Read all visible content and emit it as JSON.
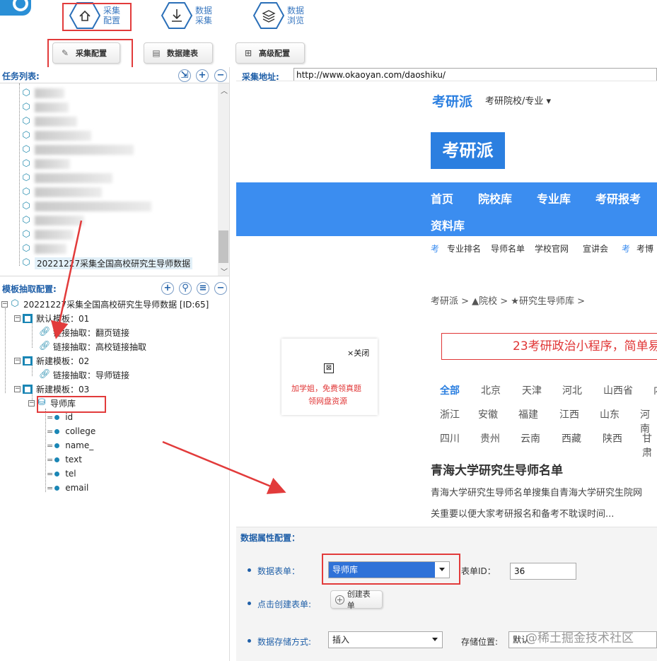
{
  "toolbar": {
    "buttons": [
      {
        "label_l1": "采集",
        "label_l2": "配置"
      },
      {
        "label_l1": "数据",
        "label_l2": "采集"
      },
      {
        "label_l1": "数据",
        "label_l2": "浏览"
      }
    ]
  },
  "subtabs": [
    {
      "label": "采集配置"
    },
    {
      "label": "数据建表"
    },
    {
      "label": "高级配置"
    }
  ],
  "task_list": {
    "label": "任务列表:",
    "last_item": "20221227采集全国高校研究生导师数据"
  },
  "url_bar": {
    "label": "采集地址:",
    "value": "http://www.okaoyan.com/daoshiku/"
  },
  "template_config": {
    "label": "模板抽取配置:",
    "root": "20221227采集全国高校研究生导师数据 [ID:65]",
    "templates": [
      {
        "name": "默认模板：01",
        "children": [
          "链接抽取：翻页链接",
          "链接抽取：高校链接抽取"
        ]
      },
      {
        "name": "新建模板：02",
        "children": [
          "链接抽取：导师链接"
        ]
      },
      {
        "name": "新建模板：03",
        "children": []
      }
    ],
    "table_node": "导师库",
    "fields": [
      "id",
      "college",
      "name_",
      "text",
      "tel",
      "email"
    ]
  },
  "site": {
    "brand": "考研派",
    "brand_menu": "考研院校/专业 ▾",
    "logo_text": "考研派",
    "nav": [
      "首页",
      "院校库",
      "专业库",
      "考研报考",
      "资料库"
    ],
    "subnav_tag1": "考",
    "subnav": [
      "专业排名",
      "导师名单",
      "学校官网",
      "宣讲会"
    ],
    "subnav_tag2": "考",
    "subnav_tail": "考博",
    "breadcrumb": "考研派 > ▲院校 > ★研究生导师库 >",
    "popup_close": "×关闭",
    "popup_line1": "加学姐，免费领真题",
    "popup_line2": "领网盘资源",
    "banner": "23考研政治小程序，简单易",
    "cities_row1": [
      "全部",
      "北京",
      "天津",
      "河北",
      "山西省",
      "内"
    ],
    "cities_row2": [
      "浙江",
      "安徽",
      "福建",
      "江西",
      "山东",
      "河南"
    ],
    "cities_row3": [
      "四川",
      "贵州",
      "云南",
      "西藏",
      "陕西",
      "甘肃"
    ],
    "article_title": "青海大学研究生导师名单",
    "article_line1": "青海大学研究生导师名单搜集自青海大学研究生院网",
    "article_line2": "关重要以便大家考研报名和备考不耽误时间..."
  },
  "props": {
    "title": "数据属性配置：",
    "table_label": "数据表单：",
    "table_value": "导师库",
    "form_id_label": "表单ID：",
    "form_id_value": "36",
    "create_label": "点击创建表单:",
    "create_button": "创建表单",
    "storage_label": "数据存储方式:",
    "storage_value": "插入",
    "location_label": "存储位置:",
    "location_value": "默认"
  },
  "watermark": "@稀土掘金技术社区",
  "colors": {
    "accent": "#1f5fa8",
    "nav_blue": "#3b8df0",
    "highlight": "#e23b3b"
  }
}
